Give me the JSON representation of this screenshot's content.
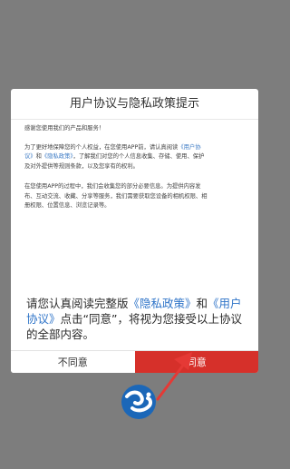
{
  "dialog": {
    "title": "用户协议与隐私政策提示",
    "greeting": "感谢您使用我们的产品和服务！",
    "para1": {
      "line1_a": "为了更好地保障您的个人权益，在您使用APP前，请认真阅读",
      "line1_link": "《用户协",
      "line2_link_a": "议》",
      "line2_and": "和",
      "line2_link_b": "《隐私政策》",
      "line2_b": "，了解我们对您的个人信息收集、存储、使用、保护",
      "line3": "及对外提供等规则条款，以及您享有的权利。"
    },
    "para2": {
      "line1": "在您使用APP的过程中，我们会收集您的部分必要信息。为提供内容发",
      "line2": "布、互动交流、收藏、分享等服务，我们需要获取您设备的相机权限、相",
      "line3": "册权限、位置信息、浏览记录等。"
    },
    "notice": {
      "text_a": "请您认真阅读完整版",
      "link_privacy": "《隐私政策》",
      "and": "和",
      "link_agreement": "《用户协议》",
      "text_b": "点击“同意”，将视为您接受以上协议的全部内容。"
    },
    "buttons": {
      "disagree": "不同意",
      "agree": "同意"
    }
  },
  "colors": {
    "overlay": "#7d7d7d",
    "agree_button": "#d6302a",
    "link": "#2f74c8",
    "arrow": "#e53935"
  },
  "icons": {
    "app_logo": "app-logo-icon",
    "arrow": "red-arrow-icon"
  }
}
